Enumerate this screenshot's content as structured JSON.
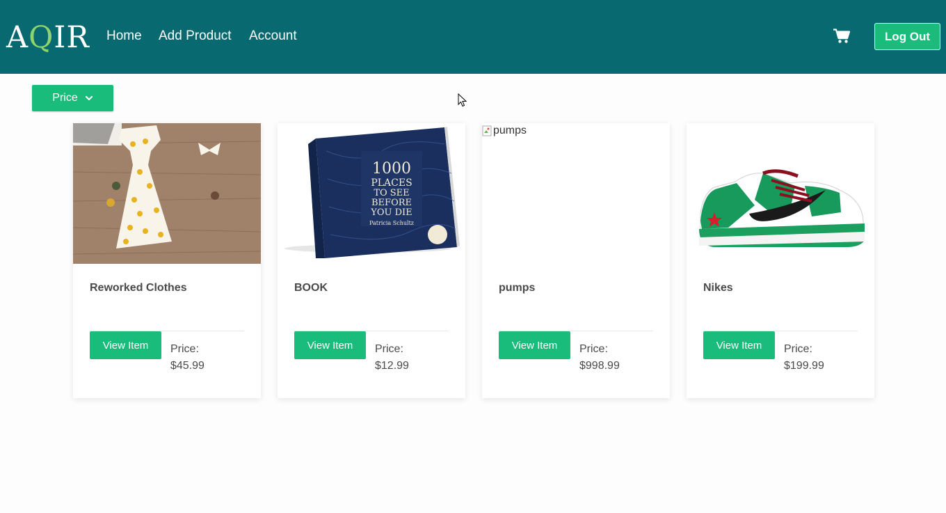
{
  "nav": {
    "logo_a": "A",
    "logo_q": "Q",
    "logo_ir": "IR",
    "links": [
      "Home",
      "Add Product",
      "Account"
    ],
    "cart_icon": "shopping-cart-icon",
    "logout_label": "Log Out"
  },
  "filter": {
    "price_label": "Price",
    "icon": "chevron-down-icon"
  },
  "products": [
    {
      "title": "Reworked Clothes",
      "view_label": "View Item",
      "price_label": "Price:",
      "price": "$45.99",
      "image": "dress-photo"
    },
    {
      "title": "BOOK",
      "view_label": "View Item",
      "price_label": "Price:",
      "price": "$12.99",
      "image": "book-photo",
      "book_line1": "1000",
      "book_line2": "PLACES",
      "book_line3": "TO SEE",
      "book_line4": "BEFORE",
      "book_line5": "YOU DIE",
      "book_author": "Patricia Schultz"
    },
    {
      "title": "pumps",
      "view_label": "View Item",
      "price_label": "Price:",
      "price": "$998.99",
      "image": "broken-image",
      "alt": "pumps"
    },
    {
      "title": "Nikes",
      "view_label": "View Item",
      "price_label": "Price:",
      "price": "$199.99",
      "image": "sneaker-photo"
    }
  ],
  "colors": {
    "navbar": "#096971",
    "accent": "#1abc7b",
    "logo_q": "#8fd46a"
  }
}
